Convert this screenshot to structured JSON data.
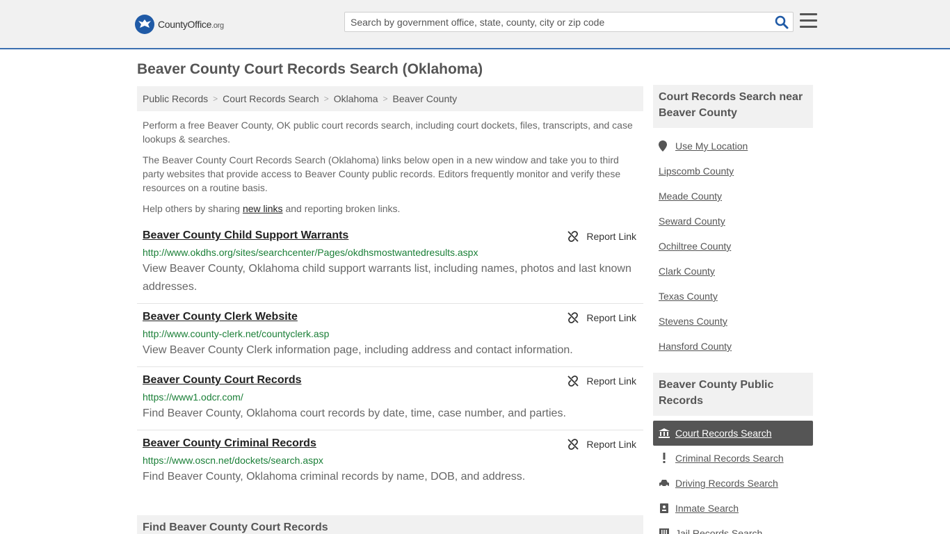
{
  "header": {
    "logo_main": "CountyOffice",
    "logo_tld": ".org",
    "search_placeholder": "Search by government office, state, county, city or zip code"
  },
  "page": {
    "title": "Beaver County Court Records Search (Oklahoma)"
  },
  "breadcrumb": [
    "Public Records",
    "Court Records Search",
    "Oklahoma",
    "Beaver County"
  ],
  "intro": {
    "p1": "Perform a free Beaver County, OK public court records search, including court dockets, files, transcripts, and case lookups & searches.",
    "p2": "The Beaver County Court Records Search (Oklahoma) links below open in a new window and take you to third party websites that provide access to Beaver County public records. Editors frequently monitor and verify these resources on a routine basis.",
    "p3_before": "Help others by sharing ",
    "p3_link": "new links",
    "p3_after": " and reporting broken links."
  },
  "report_label": "Report Link",
  "results": [
    {
      "title": "Beaver County Child Support Warrants",
      "url": "http://www.okdhs.org/sites/searchcenter/Pages/okdhsmostwantedresults.aspx",
      "desc": "View Beaver County, Oklahoma child support warrants list, including names, photos and last known addresses."
    },
    {
      "title": "Beaver County Clerk Website",
      "url": "http://www.county-clerk.net/countyclerk.asp",
      "desc": "View Beaver County Clerk information page, including address and contact information."
    },
    {
      "title": "Beaver County Court Records",
      "url": "https://www1.odcr.com/",
      "desc": "Find Beaver County, Oklahoma court records by date, time, case number, and parties."
    },
    {
      "title": "Beaver County Criminal Records",
      "url": "https://www.oscn.net/dockets/search.aspx",
      "desc": "Find Beaver County, Oklahoma criminal records by name, DOB, and address."
    }
  ],
  "find_heading": "Find Beaver County Court Records",
  "sidebar": {
    "near_heading": "Court Records Search near Beaver County",
    "use_location": "Use My Location",
    "nearby": [
      "Lipscomb County",
      "Meade County",
      "Seward County",
      "Ochiltree County",
      "Clark County",
      "Texas County",
      "Stevens County",
      "Hansford County"
    ],
    "public_heading": "Beaver County Public Records",
    "public_items": [
      {
        "label": "Court Records Search",
        "icon": "courthouse-icon",
        "active": true
      },
      {
        "label": "Criminal Records Search",
        "icon": "exclamation-icon",
        "active": false
      },
      {
        "label": "Driving Records Search",
        "icon": "car-icon",
        "active": false
      },
      {
        "label": "Inmate Search",
        "icon": "id-card-icon",
        "active": false
      },
      {
        "label": "Jail Records Search",
        "icon": "jail-icon",
        "active": false
      }
    ]
  }
}
